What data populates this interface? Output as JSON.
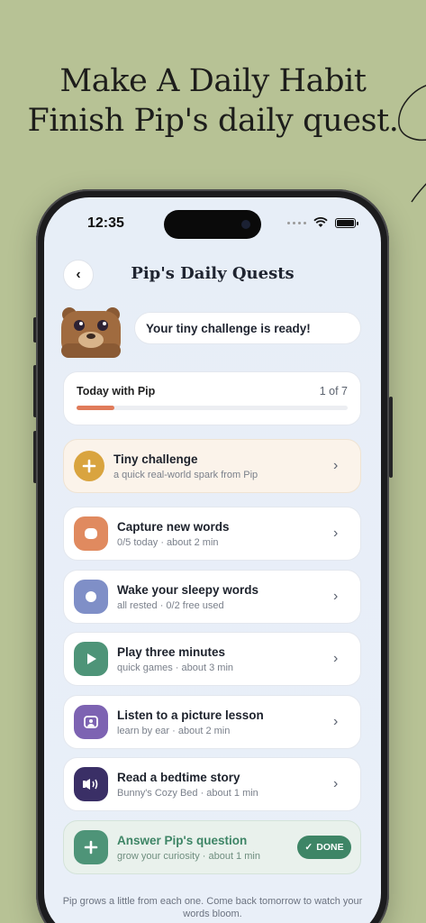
{
  "headline": {
    "line1": "Make A Daily Habit",
    "line2": "Finish Pip's daily quest."
  },
  "status": {
    "time": "12:35"
  },
  "screen_title": "Pip's Daily Quests",
  "bubble": "Your tiny challenge is ready!",
  "today": {
    "label": "Today with Pip",
    "count": "1 of 7",
    "progress": 0.14
  },
  "colors": {
    "challenge": "#d9a43f",
    "capture": "#e08a5f",
    "wake": "#7f8fc7",
    "play": "#4e9478",
    "listen": "#7d63b2",
    "read": "#3a2f66",
    "answer": "#4e9478"
  },
  "quests": [
    {
      "title": "Tiny challenge",
      "subtitle": "a quick real-world spark from Pip"
    },
    {
      "title": "Capture new words",
      "subtitle": "0/5 today · about 2 min"
    },
    {
      "title": "Wake your sleepy words",
      "subtitle": "all rested · 0/2 free used"
    },
    {
      "title": "Play three minutes",
      "subtitle": "quick games · about 3 min"
    },
    {
      "title": "Listen to a picture lesson",
      "subtitle": "learn by ear · about 2 min"
    },
    {
      "title": "Read a bedtime story",
      "subtitle": "Bunny's Cozy Bed · about 1 min"
    },
    {
      "title": "Answer Pip's question",
      "subtitle": "grow your curiosity · about 1 min",
      "badge": "DONE"
    }
  ],
  "footer": "Pip grows a little from each one. Come back tomorrow to watch your words bloom."
}
